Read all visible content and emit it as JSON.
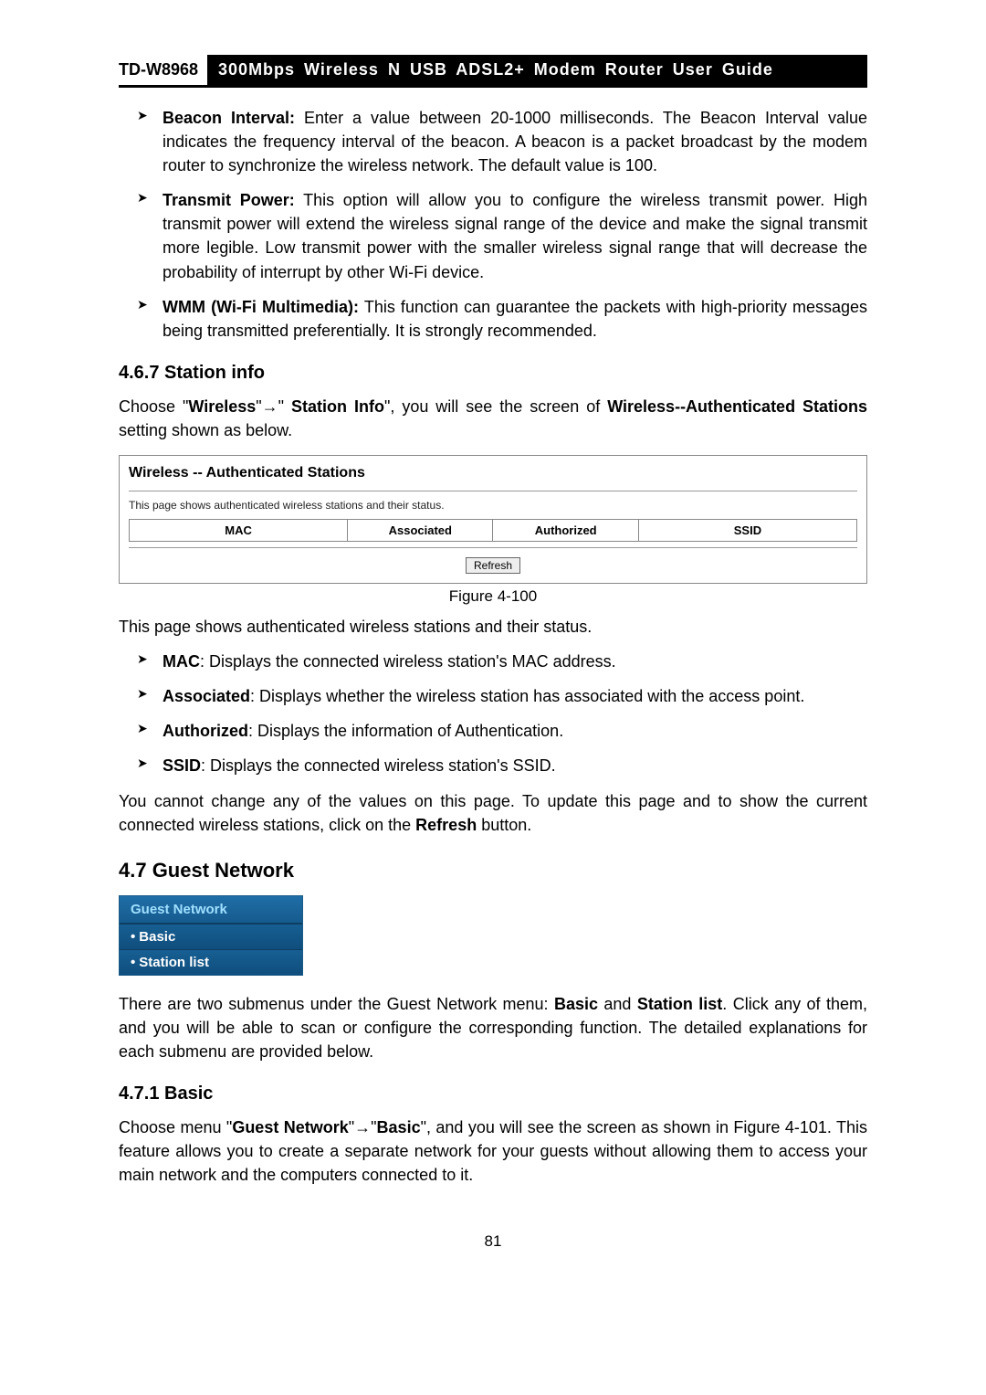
{
  "header": {
    "model": "TD-W8968",
    "title": "300Mbps Wireless N USB ADSL2+ Modem Router User Guide"
  },
  "bullets_top": [
    {
      "label": "Beacon Interval:",
      "text": " Enter a value between 20-1000 milliseconds. The Beacon Interval value indicates the frequency interval of the beacon. A beacon is a packet broadcast by the modem router to synchronize the wireless network. The default value is 100."
    },
    {
      "label": "Transmit Power:",
      "text": " This option will allow you to configure the wireless transmit power. High transmit power will extend the wireless signal range of the device and make the signal transmit more legible. Low transmit power with the smaller wireless signal range that will decrease the probability of interrupt by other Wi-Fi device."
    },
    {
      "label": "WMM (Wi-Fi Multimedia):",
      "text": " This function can guarantee the packets with high-priority messages being transmitted preferentially. It is strongly recommended."
    }
  ],
  "section_467": {
    "heading": "4.6.7  Station info",
    "intro_pre": "Choose \"",
    "intro_b1": "Wireless",
    "intro_mid1": "\"→\" ",
    "intro_b2": "Station Info",
    "intro_mid2": "\", you will see the screen of ",
    "intro_b3": "Wireless--Authenticated Stations",
    "intro_post": " setting shown as below."
  },
  "figure100": {
    "title": "Wireless -- Authenticated Stations",
    "desc": "This page shows authenticated wireless stations and their status.",
    "cols": [
      "MAC",
      "Associated",
      "Authorized",
      "SSID"
    ],
    "refresh": "Refresh",
    "caption": "Figure 4-100"
  },
  "after_fig_intro": "This page shows authenticated wireless stations and their status.",
  "bullets_mid": [
    {
      "label": "MAC",
      "text": ": Displays the connected wireless station's MAC address."
    },
    {
      "label": "Associated",
      "text": ": Displays whether the wireless station has associated with the access point."
    },
    {
      "label": "Authorized",
      "text": ": Displays the information of Authentication."
    },
    {
      "label": "SSID",
      "text": ": Displays the connected wireless station's SSID."
    }
  ],
  "cannot_change_pre": "You cannot change any of the values on this page. To update this page and to show the current connected wireless stations, click on the ",
  "cannot_change_bold": "Refresh",
  "cannot_change_post": " button.",
  "section_47": {
    "heading": "4.7  Guest Network"
  },
  "menu": {
    "header": "Guest Network",
    "items": [
      "Basic",
      "Station list"
    ]
  },
  "guest_para_pre": "There are two submenus under the Guest Network menu: ",
  "guest_para_b1": "Basic",
  "guest_para_mid": " and ",
  "guest_para_b2": "Station list",
  "guest_para_post": ". Click any of them, and you will be able to scan or configure the corresponding function. The detailed explanations for each submenu are provided below.",
  "section_471": {
    "heading": "4.7.1  Basic",
    "p_pre": "Choose menu \"",
    "p_b1": "Guest Network",
    "p_mid1": "\"→\"",
    "p_b2": "Basic",
    "p_mid2": "\", and you will see the screen as shown in Figure 4-101. This feature allows you to create a separate network for your guests without allowing them to access your main network and the computers connected to it."
  },
  "page_number": "81"
}
